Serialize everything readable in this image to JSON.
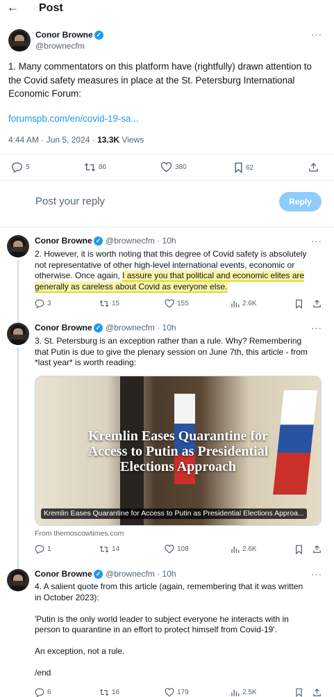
{
  "header": {
    "back_icon": "arrow-left-icon",
    "title": "Post"
  },
  "main_post": {
    "name": "Conor Browne",
    "handle": "@brownecfm",
    "text_line1": "1. Many commentators on this platform have (rightfully) drawn attention to",
    "text_line2": "the Covid safety measures in place at the St. Petersburg  International",
    "text_line3": "Economic Forum:",
    "link": "forumspb.com/en/covid-19-sa...",
    "time": "4:44 AM · Jun 5, 2024 · ",
    "views_count": "13.3K",
    "views_label": " Views",
    "actions": {
      "replies": "5",
      "reposts": "86",
      "likes": "380",
      "bookmarks": "62"
    }
  },
  "reply_box": {
    "placeholder": "Post your reply",
    "button": "Reply"
  },
  "thread": [
    {
      "name": "Conor Browne",
      "handle": "@brownecfm · 10h",
      "line1": "2. However, it is worth noting that this degree of Covid safety is absolutely",
      "line2": "not representative of other high-level international events, economic or",
      "line3_plain": "otherwise. Once again, ",
      "line3_hl": "I assure you that political and economic elites are",
      "line4_hl": "generally as careless about Covid as everyone else.",
      "actions": {
        "replies": "3",
        "reposts": "15",
        "likes": "155",
        "views": "2.6K"
      }
    },
    {
      "name": "Conor Browne",
      "handle": "@brownecfm · 10h",
      "line1": "3. St. Petersburg is an exception rather than a rule. Why? Remembering",
      "line2": "that Putin is due to give the plenary session on June 7th, this article - from",
      "line3": "*last year* is worth reading:",
      "card_title_1": "Kremlin Eases Quarantine for",
      "card_title_2": "Access to Putin as Presidential",
      "card_title_3": "Elections Approach",
      "card_caption": "Kremlin Eases Quarantine for Access to Putin as Presidential Elections Approa...",
      "card_from": "From themoscowtimes.com",
      "actions": {
        "replies": "1",
        "reposts": "14",
        "likes": "108",
        "views": "2.6K"
      }
    },
    {
      "name": "Conor Browne",
      "handle": "@brownecfm · 10h",
      "line1": "4. A salient quote from this article (again, remembering that it was written",
      "line2": "in October 2023):",
      "line3": "'Putin is the only world leader to subject everyone he interacts with in",
      "line4": "person to quarantine in an effort to protect himself from Covid-19'.",
      "line5": "An exception, not a rule.",
      "line6": "/end",
      "actions": {
        "replies": "6",
        "reposts": "16",
        "likes": "179",
        "views": "2.5K"
      }
    }
  ],
  "colors": {
    "accent": "#1d9bf0",
    "muted": "#536471",
    "text": "#0f1419",
    "reply_disabled": "#8ecdf8",
    "highlight": "#f9f6a8"
  }
}
